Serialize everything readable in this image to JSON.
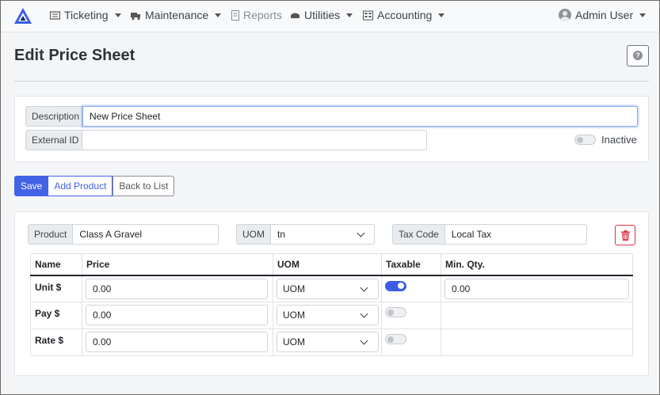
{
  "nav": {
    "items": [
      {
        "label": "Ticketing",
        "icon": "ticket-icon"
      },
      {
        "label": "Maintenance",
        "icon": "truck-icon"
      },
      {
        "label": "Reports",
        "icon": "report-icon"
      },
      {
        "label": "Utilities",
        "icon": "tools-icon"
      },
      {
        "label": "Accounting",
        "icon": "calculator-icon"
      }
    ],
    "user": "Admin User"
  },
  "page": {
    "title": "Edit Price Sheet"
  },
  "form": {
    "description_label": "Description",
    "description_value": "New Price Sheet",
    "external_id_label": "External ID",
    "external_id_value": "",
    "inactive_label": "Inactive"
  },
  "actions": {
    "save": "Save",
    "add_product": "Add Product",
    "back": "Back to List"
  },
  "product": {
    "product_label": "Product",
    "product_value": "Class A Gravel",
    "uom_label": "UOM",
    "uom_value": "tn",
    "tax_label": "Tax Code",
    "tax_value": "Local Tax"
  },
  "table": {
    "headers": [
      "Name",
      "Price",
      "UOM",
      "Taxable",
      "Min. Qty."
    ],
    "rows": [
      {
        "name": "Unit $",
        "price": "0.00",
        "uom": "UOM",
        "taxable": true,
        "min_qty": "0.00"
      },
      {
        "name": "Pay $",
        "price": "0.00",
        "uom": "UOM",
        "taxable": false,
        "min_qty": ""
      },
      {
        "name": "Rate $",
        "price": "0.00",
        "uom": "UOM",
        "taxable": false,
        "min_qty": ""
      }
    ]
  },
  "colors": {
    "primary": "#4362e8",
    "danger": "#dc3545",
    "brand": "#3b5de7"
  }
}
